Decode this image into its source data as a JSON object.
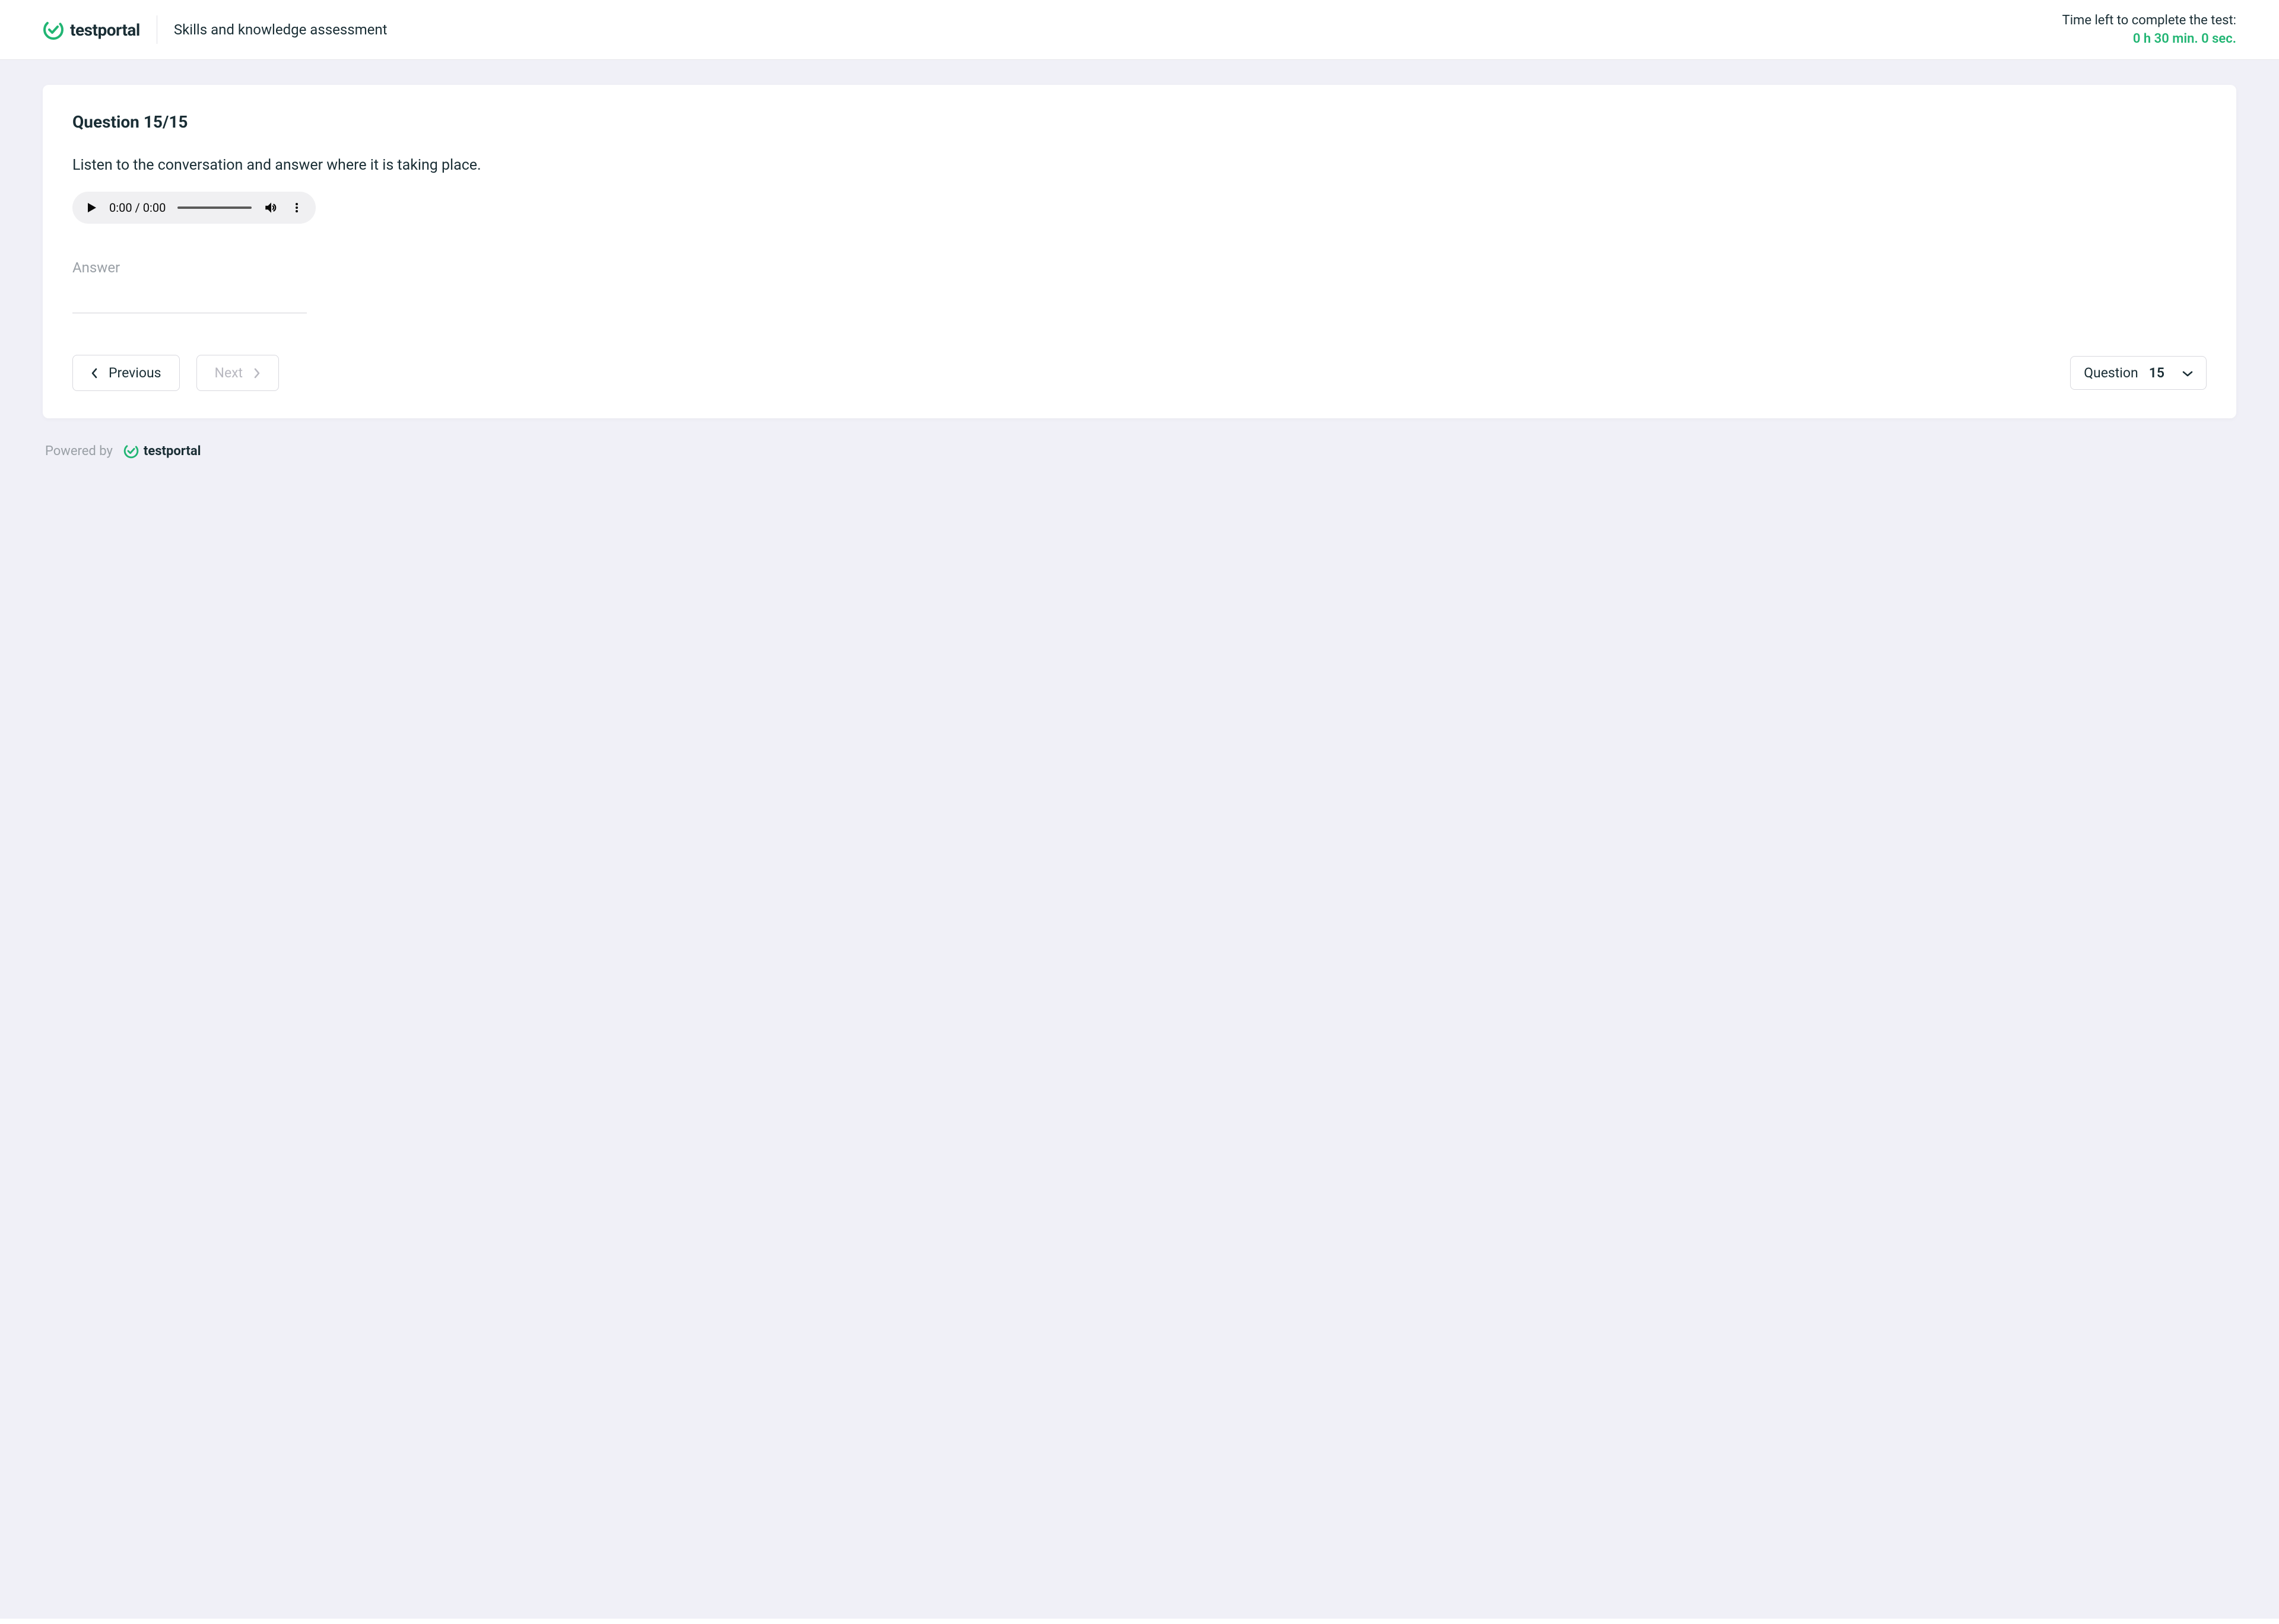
{
  "brand": {
    "name": "testportal",
    "accent_color": "#21b573"
  },
  "header": {
    "test_title": "Skills and knowledge assessment",
    "time_label": "Time left to complete the test:",
    "time_value": "0 h 30 min. 0 sec."
  },
  "question": {
    "counter_label": "Question 15/15",
    "text": "Listen to the conversation and answer where it is taking place.",
    "audio": {
      "current_time": "0:00",
      "duration": "0:00"
    },
    "answer_label": "Answer",
    "answer_value": ""
  },
  "nav": {
    "previous_label": "Previous",
    "next_label": "Next",
    "next_disabled": true,
    "selector_label": "Question",
    "selector_value": "15"
  },
  "footer": {
    "powered_by": "Powered by",
    "brand": "testportal"
  }
}
